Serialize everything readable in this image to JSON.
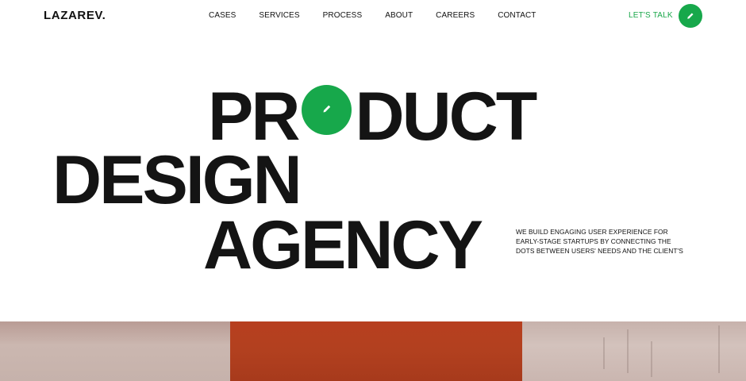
{
  "header": {
    "logo": "LAZAREV.",
    "nav": [
      {
        "label": "CASES"
      },
      {
        "label": "SERVICES"
      },
      {
        "label": "PROCESS"
      },
      {
        "label": "ABOUT"
      },
      {
        "label": "CAREERS"
      },
      {
        "label": "CONTACT"
      }
    ],
    "cta_label": "LET'S TALK",
    "cta_icon": "pencil-icon"
  },
  "hero": {
    "line1_a": "PR",
    "line1_b": "DUCT",
    "line2": "DESIGN",
    "line3": "AGENCY",
    "badge_icon": "pencil-icon",
    "description": [
      "WE BUILD ENGAGING USER EXPERIENCE FOR",
      "EARLY-STAGE STARTUPS BY CONNECTING THE",
      "DOTS BETWEEN USERS' NEEDS AND THE CLIENT'S"
    ]
  },
  "colors": {
    "accent": "#17a84b",
    "text": "#141414",
    "photo_orange": "#b3401f",
    "background": "#ffffff"
  }
}
